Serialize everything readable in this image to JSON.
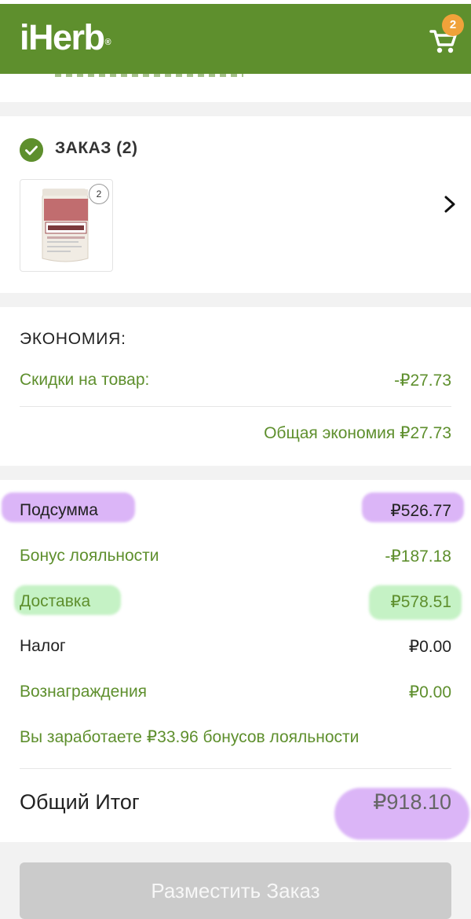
{
  "header": {
    "logo": "iHerb",
    "cart_count": "2",
    "colors": {
      "brand_green": "#5e8f2d",
      "badge_orange": "#f0a23a"
    },
    "icons": [
      "cart-icon"
    ]
  },
  "order": {
    "title": "ЗАКАЗ (2)",
    "item_quantity": "2",
    "icons": [
      "check-circle-icon",
      "chevron-right-icon"
    ]
  },
  "savings": {
    "title": "ЭКОНОМИЯ:",
    "discount_label": "Скидки на товар:",
    "discount_value": "-₽27.73",
    "total_savings": "Общая экономия ₽27.73"
  },
  "totals": {
    "subtotal_label": "Подсумма",
    "subtotal_value": "₽526.77",
    "loyalty_label": "Бонус лояльности",
    "loyalty_value": "-₽187.18",
    "shipping_label": "Доставка",
    "shipping_value": "₽578.51",
    "tax_label": "Налог",
    "tax_value": "₽0.00",
    "rewards_label": "Вознаграждения",
    "rewards_value": "₽0.00",
    "earn_note": "Вы заработаете ₽33.96 бонусов лояльности",
    "grand_total_label": "Общий Итог",
    "grand_total_value": "₽918.10"
  },
  "footer": {
    "place_order_label": "Разместить Заказ"
  }
}
